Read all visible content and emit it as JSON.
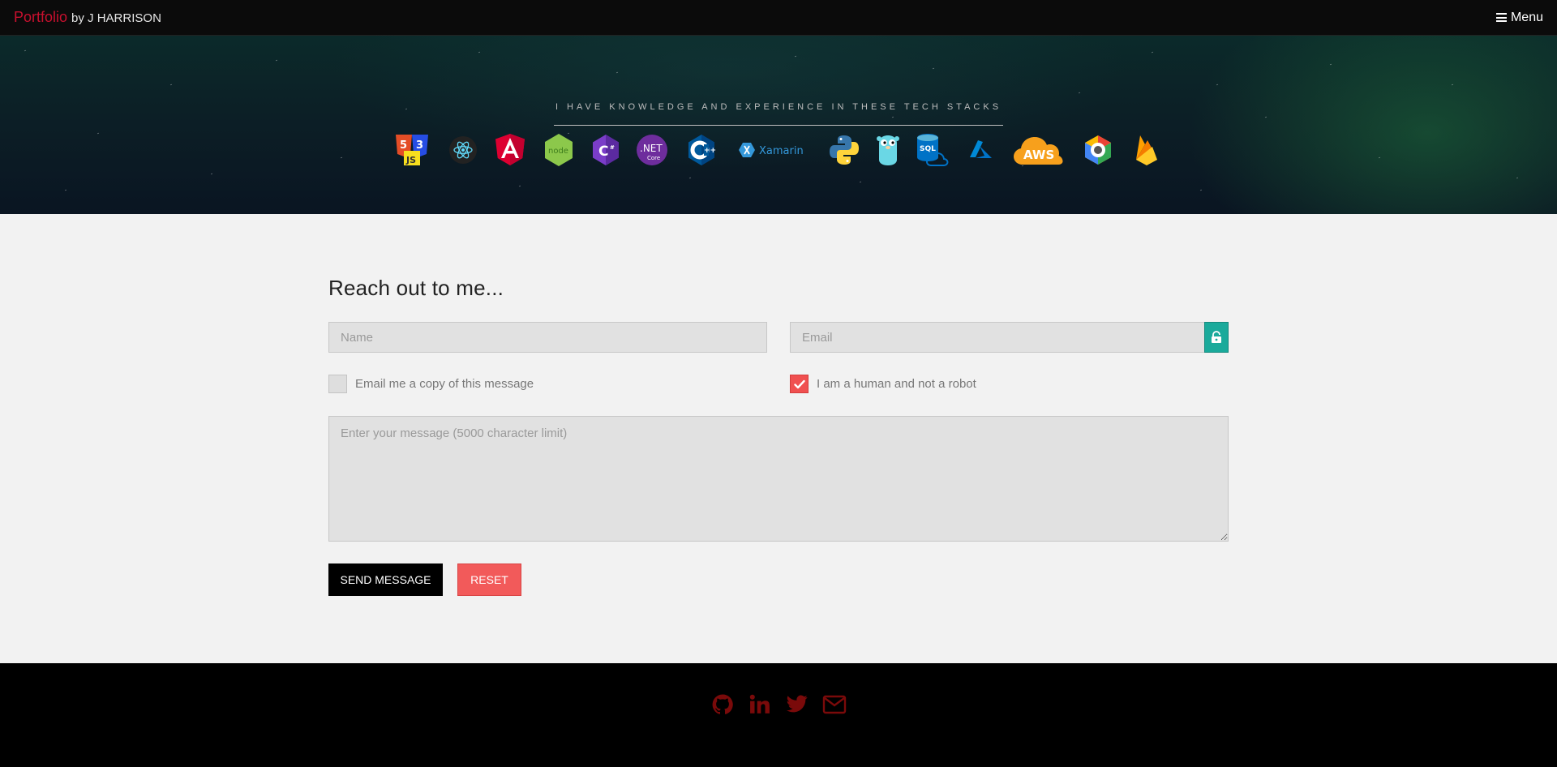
{
  "nav": {
    "brand_accent": "Portfolio",
    "brand_rest": "by J HARRISON",
    "menu_label": "Menu",
    "menu_icon": "hamburger-icon"
  },
  "hero": {
    "tagline": "I HAVE KNOWLEDGE AND EXPERIENCE IN THESE TECH STACKS",
    "stacks": [
      {
        "name": "html5-css3-js-icon"
      },
      {
        "name": "react-icon"
      },
      {
        "name": "angular-icon"
      },
      {
        "name": "nodejs-icon",
        "label": "node"
      },
      {
        "name": "csharp-icon"
      },
      {
        "name": "dotnet-core-icon",
        "label": ".NET",
        "sublabel": "Core"
      },
      {
        "name": "cplusplus-icon"
      },
      {
        "name": "xamarin-icon",
        "label": "Xamarin"
      },
      {
        "name": "python-icon"
      },
      {
        "name": "golang-gopher-icon"
      },
      {
        "name": "azure-sql-icon",
        "label": "SQL"
      },
      {
        "name": "azure-icon"
      },
      {
        "name": "aws-icon",
        "label": "AWS"
      },
      {
        "name": "google-cloud-icon"
      },
      {
        "name": "firebase-icon"
      }
    ]
  },
  "contact": {
    "heading": "Reach out to me...",
    "name_placeholder": "Name",
    "email_placeholder": "Email",
    "lock_icon": "lock-icon",
    "copy_label": "Email me a copy of this message",
    "copy_checked": false,
    "human_label": "I am a human and not a robot",
    "human_checked": true,
    "message_placeholder": "Enter your message (5000 character limit)",
    "send_label": "SEND MESSAGE",
    "reset_label": "RESET"
  },
  "footer": {
    "socials": [
      "github-icon",
      "linkedin-icon",
      "twitter-icon",
      "envelope-icon"
    ]
  },
  "colors": {
    "accent_red": "#c8102e",
    "reset_red": "#f25a5a",
    "teal": "#1aaa9b",
    "footer_icon": "#7a0a0a"
  }
}
